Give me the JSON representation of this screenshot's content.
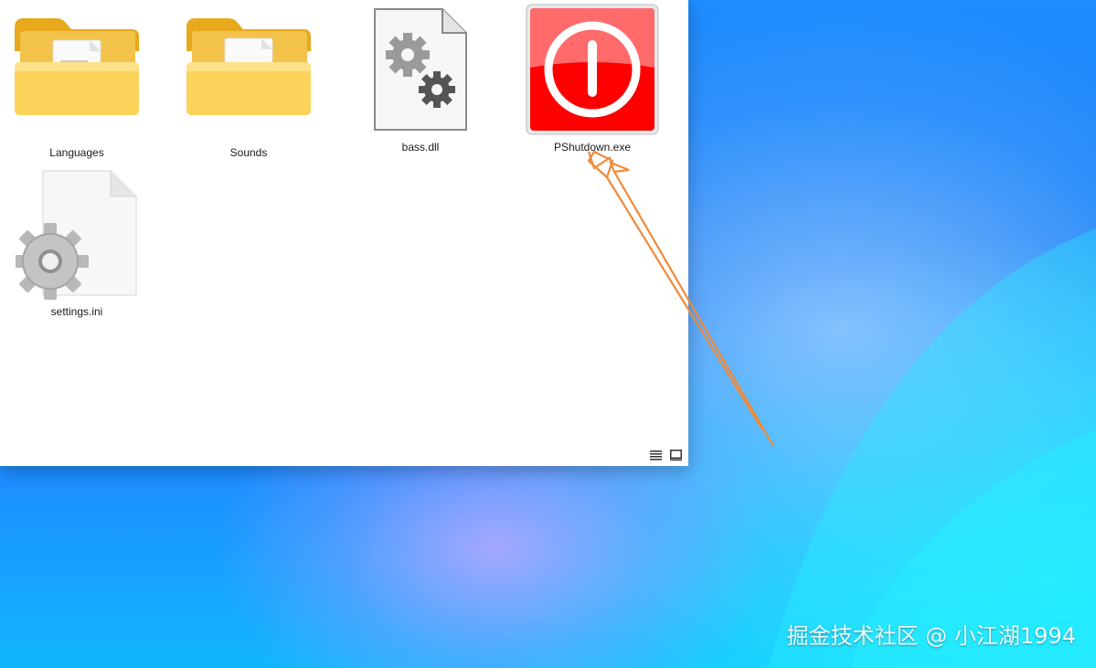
{
  "explorer": {
    "items": [
      {
        "name": "Languages",
        "type": "folder",
        "icon": "folder-documents-icon"
      },
      {
        "name": "Sounds",
        "type": "folder",
        "icon": "folder-media-icon"
      },
      {
        "name": "bass.dll",
        "type": "dll",
        "icon": "dll-gears-icon"
      },
      {
        "name": "PShutdown.exe",
        "type": "exe",
        "icon": "power-button-icon"
      },
      {
        "name": "settings.ini",
        "type": "ini",
        "icon": "settings-file-icon"
      }
    ],
    "views": [
      {
        "name": "details-view",
        "icon": "list-icon"
      },
      {
        "name": "large-icons-view",
        "icon": "tile-icon"
      }
    ]
  },
  "annotation": {
    "arrow_color": "#ef8a3a",
    "target": "PShutdown.exe"
  },
  "watermark": {
    "text": "掘金技术社区 @ 小江湖1994"
  },
  "colors": {
    "folder": "#f7c948",
    "exe_red": "#ff0000",
    "window_bg": "#ffffff"
  }
}
